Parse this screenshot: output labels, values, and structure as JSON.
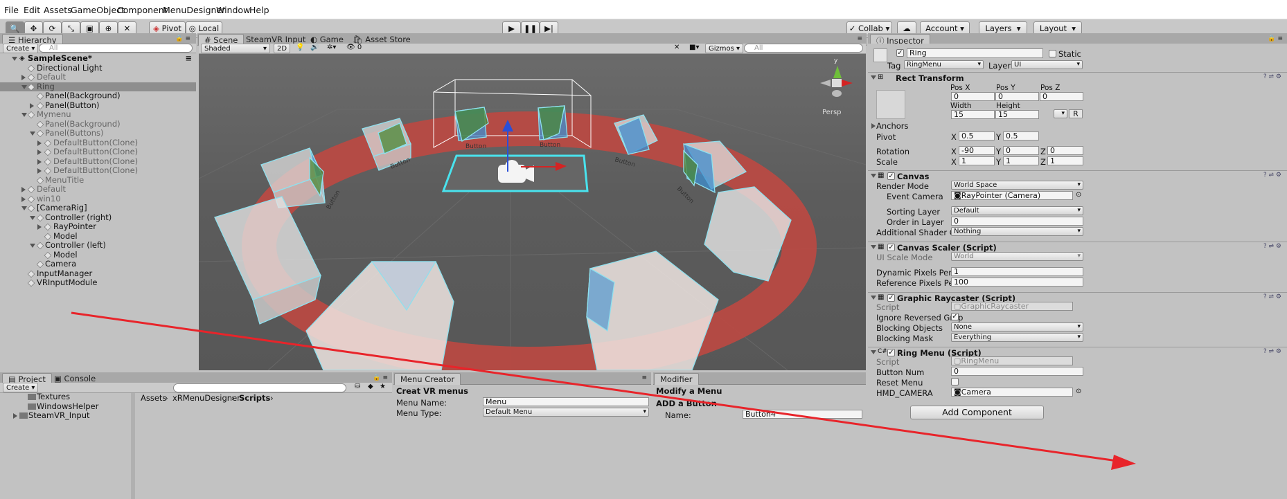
{
  "menu": [
    "File",
    "Edit",
    "Assets",
    "GameObject",
    "Component",
    "MenuDesigner",
    "Window",
    "Help"
  ],
  "toolbar": {
    "pivot": "Pivot",
    "local": "Local",
    "collab": "Collab",
    "account": "Account",
    "layers": "Layers",
    "layout": "Layout"
  },
  "hierarchy": {
    "tab": "Hierarchy",
    "create": "Create",
    "search": "All",
    "rows": [
      "SampleScene*",
      "Directional Light",
      "Default",
      "Ring",
      "Panel(Background)",
      "Panel(Button)",
      "Mymenu",
      "Panel(Background)",
      "Panel(Buttons)",
      "DefaultButton(Clone)",
      "DefaultButton(Clone)",
      "DefaultButton(Clone)",
      "DefaultButton(Clone)",
      "MenuTitle",
      "Default",
      "win10",
      "[CameraRig]",
      "Controller (right)",
      "RayPointer",
      "Model",
      "Controller (left)",
      "Model",
      "Camera",
      "InputManager",
      "VRInputModule"
    ]
  },
  "scene": {
    "tabs": [
      "Scene",
      "SteamVR Input",
      "Game",
      "Asset Store"
    ],
    "shaded": "Shaded",
    "mode2d": "2D",
    "fx_count": "0",
    "gizmos": "Gizmos",
    "search": "All",
    "persp": "Persp",
    "axis_y": "y",
    "button_labels": [
      "Button",
      "Button",
      "Button",
      "Button",
      "Button",
      "Button",
      "Button",
      "Button",
      "Button",
      "Button"
    ]
  },
  "inspector": {
    "tab": "Inspector",
    "object_name": "Ring",
    "static": "Static",
    "tag_label": "Tag",
    "tag": "RingMenu",
    "layer_label": "Layer",
    "layer": "UI",
    "rect": {
      "title": "Rect Transform",
      "posx": "Pos X",
      "posy": "Pos Y",
      "posz": "Pos Z",
      "vals": [
        "0",
        "0",
        "0"
      ],
      "width_l": "Width",
      "height_l": "Height",
      "width": "15",
      "height": "15",
      "anchors": "Anchors",
      "pivot": "Pivot",
      "pivot_x": "0.5",
      "pivot_y": "0.5",
      "rotation": "Rotation",
      "rot": [
        "-90",
        "0",
        "0"
      ],
      "scale": "Scale",
      "sc": [
        "1",
        "1",
        "1"
      ],
      "x": "X",
      "y": "Y",
      "z": "Z",
      "r": "R"
    },
    "canvas": {
      "title": "Canvas",
      "render_mode_l": "Render Mode",
      "render_mode": "World Space",
      "event_camera_l": "Event Camera",
      "event_camera": "RayPointer (Camera)",
      "sorting_layer_l": "Sorting Layer",
      "sorting_layer": "Default",
      "order_l": "Order in Layer",
      "order": "0",
      "shader_l": "Additional Shader Cha",
      "shader": "Nothing"
    },
    "scaler": {
      "title": "Canvas Scaler (Script)",
      "ui_scale_l": "UI Scale Mode",
      "ui_scale": "World",
      "dyn_l": "Dynamic Pixels Per Un",
      "dyn": "1",
      "ref_l": "Reference Pixels Per U",
      "ref": "100"
    },
    "raycaster": {
      "title": "Graphic Raycaster (Script)",
      "script_l": "Script",
      "script": "GraphicRaycaster",
      "ignore_l": "Ignore Reversed Grap",
      "block_obj_l": "Blocking Objects",
      "block_obj": "None",
      "block_mask_l": "Blocking Mask",
      "block_mask": "Everything"
    },
    "ringmenu": {
      "title": "Ring Menu (Script)",
      "script_l": "Script",
      "script": "RingMenu",
      "num_l": "Button Num",
      "num": "0",
      "reset_l": "Reset Menu",
      "hmd_l": "HMD_CAMERA",
      "hmd": "Camera"
    },
    "add_component": "Add Component"
  },
  "project": {
    "tabs": [
      "Project",
      "Console"
    ],
    "create": "Create",
    "tree": [
      "Textures",
      "WindowsHelper",
      "SteamVR_Input"
    ],
    "crumbs": [
      "Assets",
      "xRMenuDesigner",
      "Scripts"
    ]
  },
  "menu_creator": {
    "tab": "Menu Creator",
    "heading": "Creat VR menus",
    "name_l": "Menu Name:",
    "name": "Menu",
    "type_l": "Menu Type:",
    "type": "Default Menu"
  },
  "modifier": {
    "tab": "Modifier",
    "heading": "Modify a Menu",
    "add": "ADD a Button",
    "name_l": "Name:",
    "name": "Button4"
  },
  "colors": {
    "ring": "#b84a43",
    "arrow": "#e8242a",
    "selection": "#8e8e8e",
    "scene_bg": "#5e5e5e"
  }
}
